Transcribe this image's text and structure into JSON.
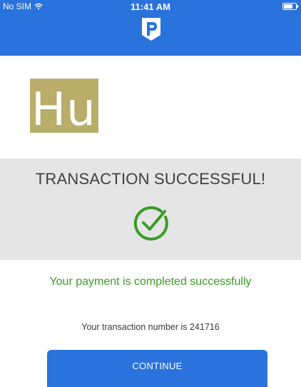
{
  "status_bar": {
    "carrier": "No SIM",
    "time": "11:41 AM"
  },
  "merchant": {
    "logo_text": "Hu",
    "logo_color": "#b8ad69"
  },
  "result": {
    "title": "TRANSACTION SUCCESSFUL!",
    "message": "Your payment is completed successfully",
    "transaction_label": "Your transaction number is 241716"
  },
  "actions": {
    "continue_label": "CONTINUE"
  },
  "colors": {
    "brand_blue": "#2a72dc",
    "success_green": "#3a9b25",
    "panel_gray": "#e5e5e5"
  },
  "icons": {
    "brand": "p-logo-icon",
    "success": "check-circle-icon"
  }
}
